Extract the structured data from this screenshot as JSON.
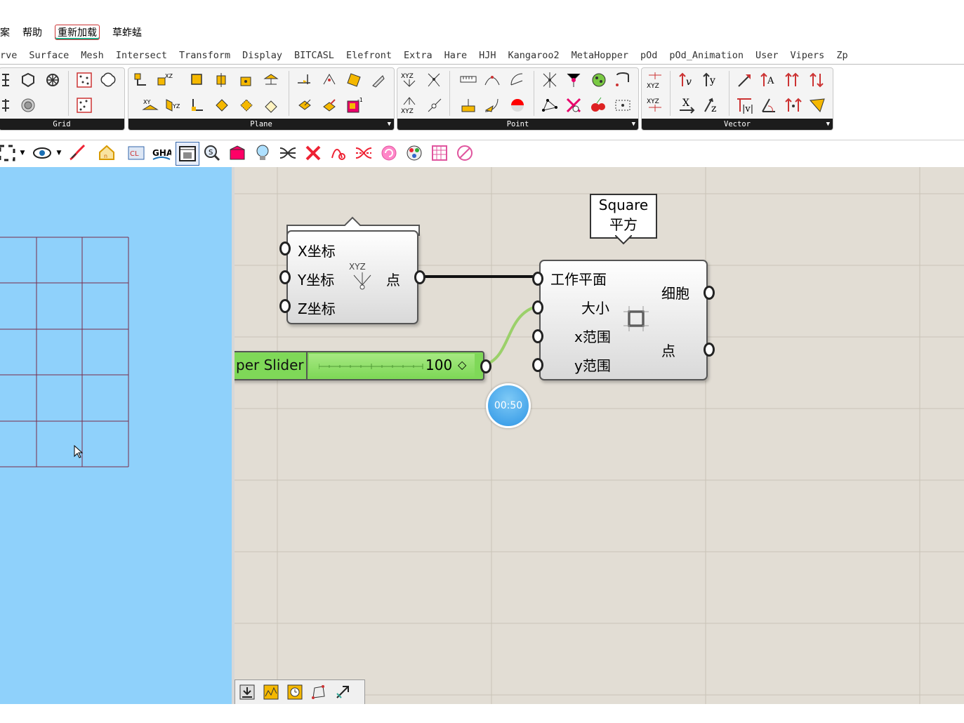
{
  "menu": {
    "items": [
      "案",
      "帮助",
      "重新加载",
      "草蚱蜢"
    ]
  },
  "tabs": [
    "rve",
    "Surface",
    "Mesh",
    "Intersect",
    "Transform",
    "Display",
    "BITCASL",
    "Elefront",
    "Extra",
    "Hare",
    "HJH",
    "Kangaroo2",
    "MetaHopper",
    "pOd",
    "pOd_Animation",
    "User",
    "Vipers",
    "Zp"
  ],
  "ribbon": {
    "panels": [
      "Grid",
      "Plane",
      "Point",
      "Vector"
    ]
  },
  "canvas": {
    "pt_component": {
      "inputs": [
        "X坐标",
        "Y坐标",
        "Z坐标"
      ],
      "output": "点",
      "icon_text": "XYZ"
    },
    "square_tooltip": {
      "line1": "Square",
      "line2": "平方"
    },
    "square_component": {
      "inputs": [
        "工作平面",
        "大小",
        "x范围",
        "y范围"
      ],
      "outputs": [
        "细胞",
        "点"
      ]
    },
    "slider": {
      "label": "per Slider",
      "value": "100"
    },
    "timer": "00:50"
  },
  "colors": {
    "viewport_bg": "#8fd1fb",
    "canvas_bg": "#e2ddd4",
    "slider_green": "#7fd858",
    "grid_line": "#7a2a4a"
  }
}
